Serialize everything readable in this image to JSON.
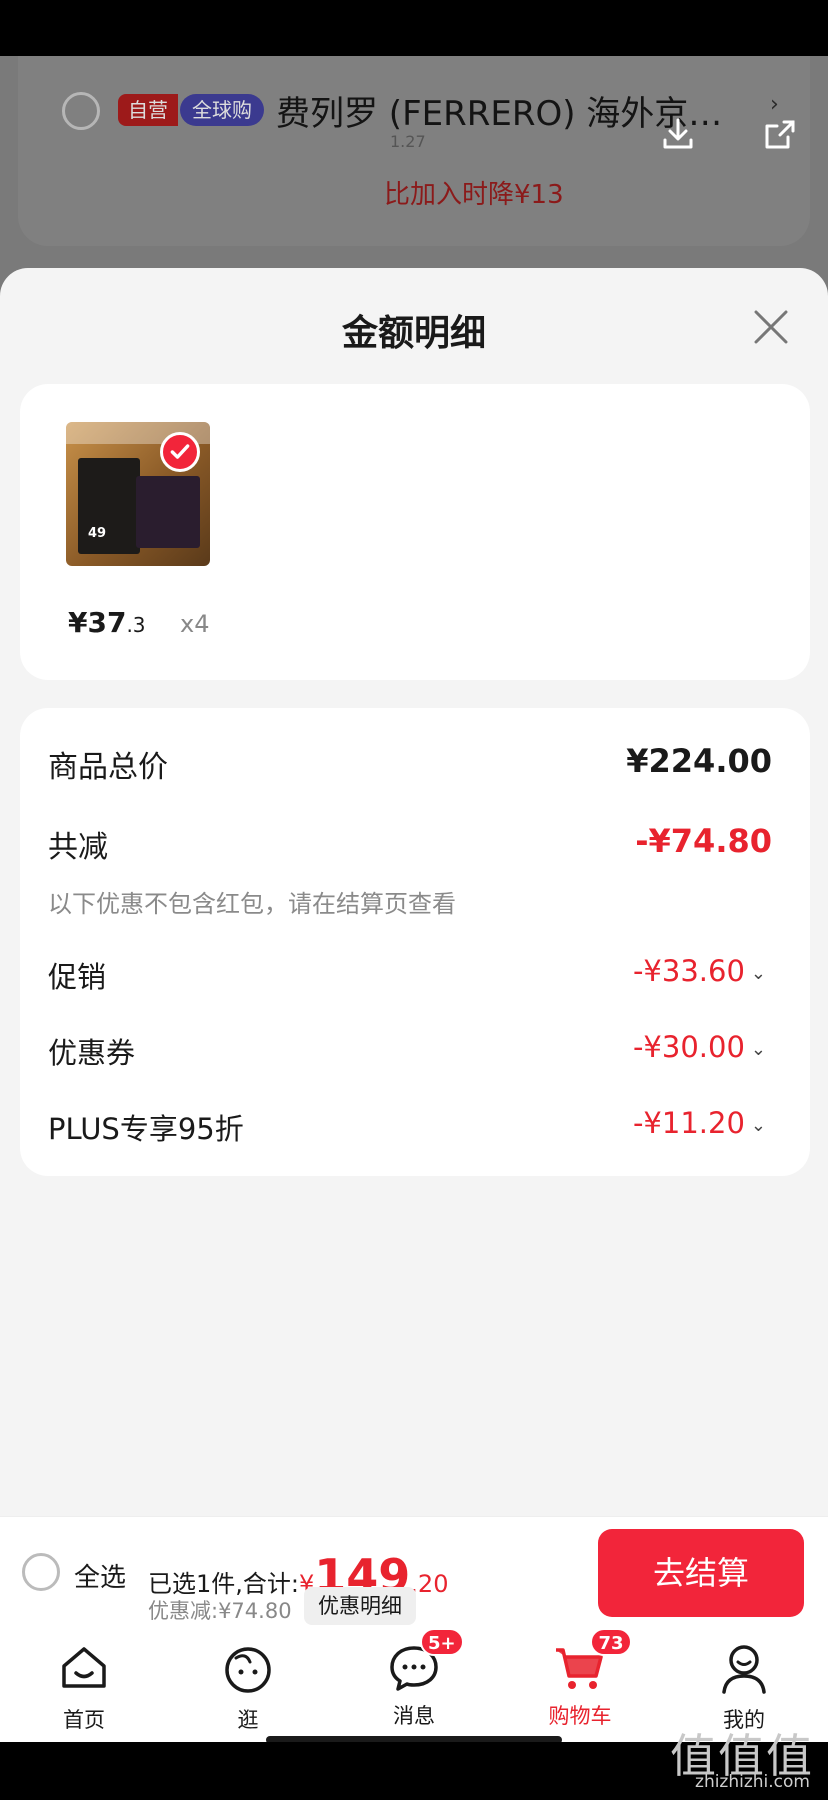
{
  "background": {
    "tag_self": "自营",
    "tag_global": "全球购",
    "product_title": "费列罗 (FERRERO) 海外京…",
    "sub_text": "1.27",
    "price_drop": "比加入时降¥13"
  },
  "sheet": {
    "title": "金额明细"
  },
  "item": {
    "thumb_num": "49",
    "price_int": "¥37",
    "price_dec": ".3",
    "quantity": "x4"
  },
  "summary": {
    "total_label": "商品总价",
    "total_value": "¥224.00",
    "reduce_label": "共减",
    "reduce_value": "-¥74.80",
    "note": "以下优惠不包含红包，请在结算页查看",
    "discounts": [
      {
        "label": "促销",
        "value": "-¥33.60"
      },
      {
        "label": "优惠券",
        "value": "-¥30.00"
      },
      {
        "label": "PLUS专享95折",
        "value": "-¥11.20"
      }
    ]
  },
  "checkout": {
    "select_all": "全选",
    "selected_text": "已选1件,合计:",
    "yen": "¥",
    "amount_int": "149",
    "amount_dec": ".20",
    "saved_text": "优惠减:¥74.80",
    "detail_label": "优惠明细",
    "button_label": "去结算"
  },
  "tabs": [
    {
      "label": "首页",
      "icon": "home-icon"
    },
    {
      "label": "逛",
      "icon": "face-icon"
    },
    {
      "label": "消息",
      "icon": "message-icon",
      "badge": "5+"
    },
    {
      "label": "购物车",
      "icon": "cart-icon",
      "badge": "73"
    },
    {
      "label": "我的",
      "icon": "profile-icon"
    }
  ],
  "watermark": {
    "logo": "值值值",
    "url": "zhizhizhi.com"
  },
  "colors": {
    "accent": "#f2253a",
    "price_red": "#e8232e"
  }
}
